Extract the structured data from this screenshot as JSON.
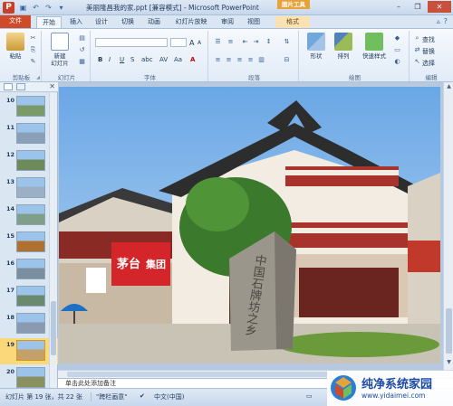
{
  "titlebar": {
    "app_logo": "P",
    "title": "美丽隆昌我的家.ppt [兼容模式] - Microsoft PowerPoint",
    "context_tab_group": "图片工具"
  },
  "tabs": [
    {
      "label": "文件"
    },
    {
      "label": "开始"
    },
    {
      "label": "插入"
    },
    {
      "label": "设计"
    },
    {
      "label": "切换"
    },
    {
      "label": "动画"
    },
    {
      "label": "幻灯片放映"
    },
    {
      "label": "审阅"
    },
    {
      "label": "视图"
    },
    {
      "label": "格式"
    }
  ],
  "ribbon": {
    "clipboard": {
      "paste": "粘贴",
      "label": "剪贴板"
    },
    "slides": {
      "new_slide": "新建\n幻灯片",
      "label": "幻灯片"
    },
    "font": {
      "bold": "B",
      "italic": "I",
      "underline": "U",
      "strike": "S",
      "shadow": "abc",
      "spacing": "AV",
      "case": "Aa",
      "color": "A",
      "grow": "A",
      "shrink": "A",
      "label": "字体"
    },
    "paragraph": {
      "label": "段落"
    },
    "drawing": {
      "shapes": "形状",
      "arrange": "排列",
      "quick_styles": "快速样式",
      "label": "绘图"
    },
    "editing": {
      "find": "查找",
      "replace": "替换",
      "select": "选择",
      "label": "编辑"
    }
  },
  "slides_pane": {
    "thumbnails": [
      {
        "num": "10"
      },
      {
        "num": "11"
      },
      {
        "num": "12"
      },
      {
        "num": "13"
      },
      {
        "num": "14"
      },
      {
        "num": "15"
      },
      {
        "num": "16"
      },
      {
        "num": "17"
      },
      {
        "num": "18"
      },
      {
        "num": "19"
      },
      {
        "num": "20"
      }
    ],
    "selected": "19"
  },
  "slide": {
    "stone_text": "中国石牌坊之乡",
    "sign_text": "茅台",
    "sign_text2": "集团"
  },
  "notes": {
    "placeholder": "单击此处添加备注"
  },
  "statusbar": {
    "slide_info": "幻灯片 第 19 张，共 22 张",
    "theme": "\"跨栏画意\"",
    "language": "中文(中国)"
  },
  "watermark": {
    "title": "纯净系统家园",
    "url": "www.yidaimei.com"
  },
  "colors": {
    "file_tab": "#d04a2c",
    "context_tab": "#e8a23a",
    "selected_thumb": "#fbd97a"
  }
}
